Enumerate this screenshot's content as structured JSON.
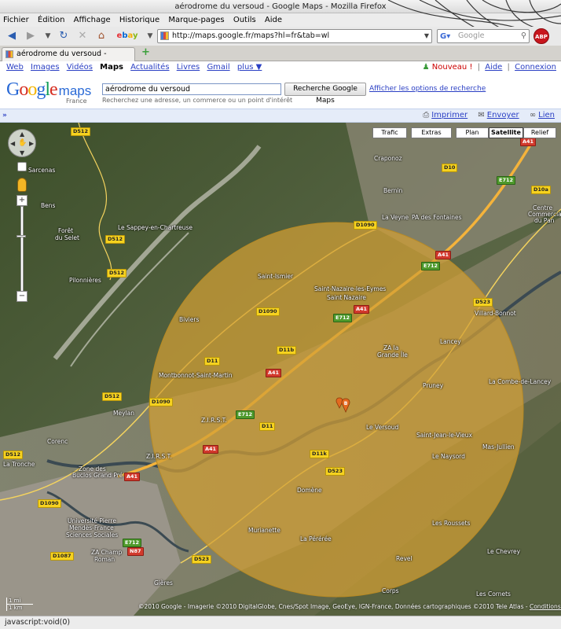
{
  "window": {
    "title": "aérodrome du versoud - Google Maps - Mozilla Firefox"
  },
  "menu": [
    "Fichier",
    "Édition",
    "Affichage",
    "Historique",
    "Marque-pages",
    "Outils",
    "Aide"
  ],
  "toolbar": {
    "url": "http://maps.google.fr/maps?hl=fr&tab=wl",
    "search_placeholder": "Google",
    "adblock_label": "ABP"
  },
  "tab": {
    "label": "aérodrome du versoud - Google Maps",
    "new_tab": "+"
  },
  "gbar": {
    "links": [
      "Web",
      "Images",
      "Vidéos"
    ],
    "active": "Maps",
    "links2": [
      "Actualités",
      "Livres",
      "Gmail",
      "plus ▼"
    ],
    "right_new": "Nouveau !",
    "right_aide": "Aide",
    "right_connexion": "Connexion",
    "sep": "|"
  },
  "header": {
    "logo": "Google",
    "logo_maps": "maps",
    "logo_sub": "France",
    "query": "aérodrome du versoud",
    "query_hint": "Recherchez une adresse, un commerce ou un point d'intérêt",
    "search_button": "Recherche Google Maps",
    "options_link": "Afficher les options de recherche"
  },
  "utility": {
    "collapse": "»",
    "print": "Imprimer",
    "send": "Envoyer",
    "link": "Lien"
  },
  "maptypes": [
    "Trafic",
    "Extras",
    "Plan",
    "Satellite",
    "Relief"
  ],
  "selected_maptype": "Satellite",
  "places": {
    "sarcenas": "Sarcenas",
    "bens": "Bens",
    "foret": "Forêt",
    "foret2": "du Selet",
    "sappey": "Le Sappey-en-Chartreuse",
    "pilonnieres": "Pilonnières",
    "craponoz": "Craponoz",
    "bernin": "Bernin",
    "veyne": "La Veyne",
    "champs": "PA des Fontaines",
    "centre": "Centre",
    "commercial": "Commercial",
    "du_pan": "du Pan",
    "saint_ismier": "Saint-Ismier",
    "saint_nazaire": "Saint-Nazaire-les-Eymes",
    "saint_nazaire2": "Saint Nazaire",
    "biviers": "Biviers",
    "villard": "Villard-Bonnot",
    "lancey": "Lancey",
    "grande_ile": "ZA la",
    "grande_ile2": "Grande Île",
    "montbonnot": "Montbonnot-Saint-Martin",
    "pruney": "Pruney",
    "combe": "La Combe-de-Lancey",
    "meylan": "Meylan",
    "versoud": "Le Versoud",
    "saint_jean": "Saint-Jean-le-Vieux",
    "mas_jullien": "Mas-Jullien",
    "naysord": "Le Naysord",
    "corenc": "Corenc",
    "la_tronche": "La Tronche",
    "zirst": "Z.I.R.S.T.",
    "zirst2": "Z.I.R.S.T.",
    "domene": "Domène",
    "murianette": "Murianette",
    "la_pererre": "La Pérérée",
    "revel": "Revel",
    "les_roussets": "Les Roussets",
    "le_chevrey": "Le Chevrey",
    "les_cornets": "Les Cornets",
    "corps": "Corps",
    "gieres": "Gières",
    "univ": "Université Pierre",
    "univ2": "Mendès-France",
    "univ3": "Sciences Sociales",
    "za_champ": "ZA Champ",
    "za_champ2": "Roman",
    "buclos": "Zone des",
    "buclos2": "Buclos Grand Pré"
  },
  "roads": {
    "d512a": "D512",
    "d512b": "D512",
    "d512c": "D512",
    "d512d": "D512",
    "d512e": "D512",
    "a41a": "A41",
    "a41b": "A41",
    "a41c": "A41",
    "a41d": "A41",
    "a41e": "A41",
    "a41f": "A41",
    "e712a": "E712",
    "e712b": "E712",
    "e712c": "E712",
    "e712d": "E712",
    "e712e": "E712",
    "d10": "D10",
    "d10a": "D10a",
    "d1090a": "D1090",
    "d1090b": "D1090",
    "d1090c": "D1090",
    "d1090d": "D1090",
    "d11a": "D11",
    "d11b": "D11b",
    "d11c": "D11",
    "d11k": "D11k",
    "d523a": "D523",
    "d523b": "D523",
    "d523c": "D523",
    "d1087": "D1087",
    "n87": "N87"
  },
  "marker_letter": "B",
  "scale": "1 mi",
  "scale2": "1 km",
  "footer": {
    "text": "©2010 Google - Imagerie ©2010 DigitalGlobe, Cnes/Spot Image, GeoEye, IGN-France, Données cartographiques ©2010 Tele Atlas -",
    "terms": "Conditions d'utilisation"
  },
  "statusbar": "javascript:void(0)",
  "colors": {
    "circle": "#d3a035",
    "link": "#2a3fc4",
    "highway": "#f4b33b"
  }
}
